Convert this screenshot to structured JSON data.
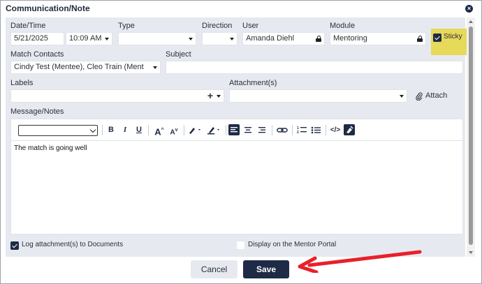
{
  "dialog": {
    "title": "Communication/Note"
  },
  "labels": {
    "datetime": "Date/Time",
    "type": "Type",
    "direction": "Direction",
    "user": "User",
    "module": "Module",
    "match_contacts": "Match Contacts",
    "subject": "Subject",
    "labels": "Labels",
    "attachments": "Attachment(s)",
    "message": "Message/Notes"
  },
  "fields": {
    "date": "5/21/2025",
    "time": "10:09 AM",
    "type": "",
    "direction": "",
    "user": "Amanda Diehl",
    "module": "Mentoring",
    "match_contacts": "Cindy Test (Mentee), Cleo Train (Ment",
    "subject": "",
    "labels": "",
    "attachments": ""
  },
  "sticky": {
    "label": "Sticky",
    "checked": true
  },
  "attach_button": {
    "label": "Attach"
  },
  "labels_add": "+",
  "editor": {
    "format_select": "",
    "content": "The match is going well"
  },
  "options": {
    "log_attachments": {
      "label": "Log attachment(s) to Documents",
      "checked": true
    },
    "display_portal": {
      "label": "Display on the Mentor Portal",
      "checked": false
    }
  },
  "buttons": {
    "cancel": "Cancel",
    "save": "Save"
  },
  "colors": {
    "primary": "#1e2b46",
    "sticky_highlight": "#e7d95a",
    "annotation_arrow": "#e8202a",
    "form_bg": "#e6eaf0"
  }
}
